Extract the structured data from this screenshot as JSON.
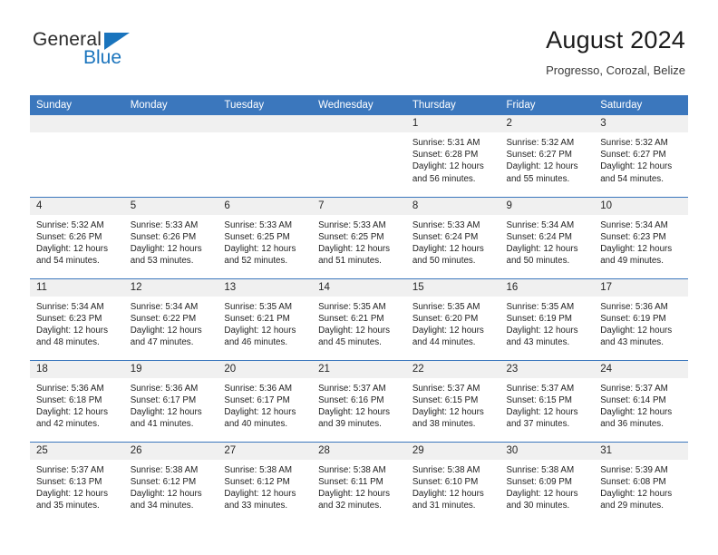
{
  "brand": {
    "name_part1": "General",
    "name_part2": "Blue",
    "triangle_color": "#1a74bd"
  },
  "header": {
    "title": "August 2024",
    "subtitle": "Progresso, Corozal, Belize"
  },
  "theme": {
    "header_blue": "#3b77bd",
    "daynum_band": "#f0f0f0",
    "text": "#1f1f1f"
  },
  "weekday_headers": [
    "Sunday",
    "Monday",
    "Tuesday",
    "Wednesday",
    "Thursday",
    "Friday",
    "Saturday"
  ],
  "weeks": [
    [
      {
        "day": "",
        "blank": true,
        "sunrise": "",
        "sunset": "",
        "daylight1": "",
        "daylight2": ""
      },
      {
        "day": "",
        "blank": true,
        "sunrise": "",
        "sunset": "",
        "daylight1": "",
        "daylight2": ""
      },
      {
        "day": "",
        "blank": true,
        "sunrise": "",
        "sunset": "",
        "daylight1": "",
        "daylight2": ""
      },
      {
        "day": "",
        "blank": true,
        "sunrise": "",
        "sunset": "",
        "daylight1": "",
        "daylight2": ""
      },
      {
        "day": "1",
        "blank": false,
        "sunrise": "Sunrise: 5:31 AM",
        "sunset": "Sunset: 6:28 PM",
        "daylight1": "Daylight: 12 hours",
        "daylight2": "and 56 minutes."
      },
      {
        "day": "2",
        "blank": false,
        "sunrise": "Sunrise: 5:32 AM",
        "sunset": "Sunset: 6:27 PM",
        "daylight1": "Daylight: 12 hours",
        "daylight2": "and 55 minutes."
      },
      {
        "day": "3",
        "blank": false,
        "sunrise": "Sunrise: 5:32 AM",
        "sunset": "Sunset: 6:27 PM",
        "daylight1": "Daylight: 12 hours",
        "daylight2": "and 54 minutes."
      }
    ],
    [
      {
        "day": "4",
        "blank": false,
        "sunrise": "Sunrise: 5:32 AM",
        "sunset": "Sunset: 6:26 PM",
        "daylight1": "Daylight: 12 hours",
        "daylight2": "and 54 minutes."
      },
      {
        "day": "5",
        "blank": false,
        "sunrise": "Sunrise: 5:33 AM",
        "sunset": "Sunset: 6:26 PM",
        "daylight1": "Daylight: 12 hours",
        "daylight2": "and 53 minutes."
      },
      {
        "day": "6",
        "blank": false,
        "sunrise": "Sunrise: 5:33 AM",
        "sunset": "Sunset: 6:25 PM",
        "daylight1": "Daylight: 12 hours",
        "daylight2": "and 52 minutes."
      },
      {
        "day": "7",
        "blank": false,
        "sunrise": "Sunrise: 5:33 AM",
        "sunset": "Sunset: 6:25 PM",
        "daylight1": "Daylight: 12 hours",
        "daylight2": "and 51 minutes."
      },
      {
        "day": "8",
        "blank": false,
        "sunrise": "Sunrise: 5:33 AM",
        "sunset": "Sunset: 6:24 PM",
        "daylight1": "Daylight: 12 hours",
        "daylight2": "and 50 minutes."
      },
      {
        "day": "9",
        "blank": false,
        "sunrise": "Sunrise: 5:34 AM",
        "sunset": "Sunset: 6:24 PM",
        "daylight1": "Daylight: 12 hours",
        "daylight2": "and 50 minutes."
      },
      {
        "day": "10",
        "blank": false,
        "sunrise": "Sunrise: 5:34 AM",
        "sunset": "Sunset: 6:23 PM",
        "daylight1": "Daylight: 12 hours",
        "daylight2": "and 49 minutes."
      }
    ],
    [
      {
        "day": "11",
        "blank": false,
        "sunrise": "Sunrise: 5:34 AM",
        "sunset": "Sunset: 6:23 PM",
        "daylight1": "Daylight: 12 hours",
        "daylight2": "and 48 minutes."
      },
      {
        "day": "12",
        "blank": false,
        "sunrise": "Sunrise: 5:34 AM",
        "sunset": "Sunset: 6:22 PM",
        "daylight1": "Daylight: 12 hours",
        "daylight2": "and 47 minutes."
      },
      {
        "day": "13",
        "blank": false,
        "sunrise": "Sunrise: 5:35 AM",
        "sunset": "Sunset: 6:21 PM",
        "daylight1": "Daylight: 12 hours",
        "daylight2": "and 46 minutes."
      },
      {
        "day": "14",
        "blank": false,
        "sunrise": "Sunrise: 5:35 AM",
        "sunset": "Sunset: 6:21 PM",
        "daylight1": "Daylight: 12 hours",
        "daylight2": "and 45 minutes."
      },
      {
        "day": "15",
        "blank": false,
        "sunrise": "Sunrise: 5:35 AM",
        "sunset": "Sunset: 6:20 PM",
        "daylight1": "Daylight: 12 hours",
        "daylight2": "and 44 minutes."
      },
      {
        "day": "16",
        "blank": false,
        "sunrise": "Sunrise: 5:35 AM",
        "sunset": "Sunset: 6:19 PM",
        "daylight1": "Daylight: 12 hours",
        "daylight2": "and 43 minutes."
      },
      {
        "day": "17",
        "blank": false,
        "sunrise": "Sunrise: 5:36 AM",
        "sunset": "Sunset: 6:19 PM",
        "daylight1": "Daylight: 12 hours",
        "daylight2": "and 43 minutes."
      }
    ],
    [
      {
        "day": "18",
        "blank": false,
        "sunrise": "Sunrise: 5:36 AM",
        "sunset": "Sunset: 6:18 PM",
        "daylight1": "Daylight: 12 hours",
        "daylight2": "and 42 minutes."
      },
      {
        "day": "19",
        "blank": false,
        "sunrise": "Sunrise: 5:36 AM",
        "sunset": "Sunset: 6:17 PM",
        "daylight1": "Daylight: 12 hours",
        "daylight2": "and 41 minutes."
      },
      {
        "day": "20",
        "blank": false,
        "sunrise": "Sunrise: 5:36 AM",
        "sunset": "Sunset: 6:17 PM",
        "daylight1": "Daylight: 12 hours",
        "daylight2": "and 40 minutes."
      },
      {
        "day": "21",
        "blank": false,
        "sunrise": "Sunrise: 5:37 AM",
        "sunset": "Sunset: 6:16 PM",
        "daylight1": "Daylight: 12 hours",
        "daylight2": "and 39 minutes."
      },
      {
        "day": "22",
        "blank": false,
        "sunrise": "Sunrise: 5:37 AM",
        "sunset": "Sunset: 6:15 PM",
        "daylight1": "Daylight: 12 hours",
        "daylight2": "and 38 minutes."
      },
      {
        "day": "23",
        "blank": false,
        "sunrise": "Sunrise: 5:37 AM",
        "sunset": "Sunset: 6:15 PM",
        "daylight1": "Daylight: 12 hours",
        "daylight2": "and 37 minutes."
      },
      {
        "day": "24",
        "blank": false,
        "sunrise": "Sunrise: 5:37 AM",
        "sunset": "Sunset: 6:14 PM",
        "daylight1": "Daylight: 12 hours",
        "daylight2": "and 36 minutes."
      }
    ],
    [
      {
        "day": "25",
        "blank": false,
        "sunrise": "Sunrise: 5:37 AM",
        "sunset": "Sunset: 6:13 PM",
        "daylight1": "Daylight: 12 hours",
        "daylight2": "and 35 minutes."
      },
      {
        "day": "26",
        "blank": false,
        "sunrise": "Sunrise: 5:38 AM",
        "sunset": "Sunset: 6:12 PM",
        "daylight1": "Daylight: 12 hours",
        "daylight2": "and 34 minutes."
      },
      {
        "day": "27",
        "blank": false,
        "sunrise": "Sunrise: 5:38 AM",
        "sunset": "Sunset: 6:12 PM",
        "daylight1": "Daylight: 12 hours",
        "daylight2": "and 33 minutes."
      },
      {
        "day": "28",
        "blank": false,
        "sunrise": "Sunrise: 5:38 AM",
        "sunset": "Sunset: 6:11 PM",
        "daylight1": "Daylight: 12 hours",
        "daylight2": "and 32 minutes."
      },
      {
        "day": "29",
        "blank": false,
        "sunrise": "Sunrise: 5:38 AM",
        "sunset": "Sunset: 6:10 PM",
        "daylight1": "Daylight: 12 hours",
        "daylight2": "and 31 minutes."
      },
      {
        "day": "30",
        "blank": false,
        "sunrise": "Sunrise: 5:38 AM",
        "sunset": "Sunset: 6:09 PM",
        "daylight1": "Daylight: 12 hours",
        "daylight2": "and 30 minutes."
      },
      {
        "day": "31",
        "blank": false,
        "sunrise": "Sunrise: 5:39 AM",
        "sunset": "Sunset: 6:08 PM",
        "daylight1": "Daylight: 12 hours",
        "daylight2": "and 29 minutes."
      }
    ]
  ]
}
